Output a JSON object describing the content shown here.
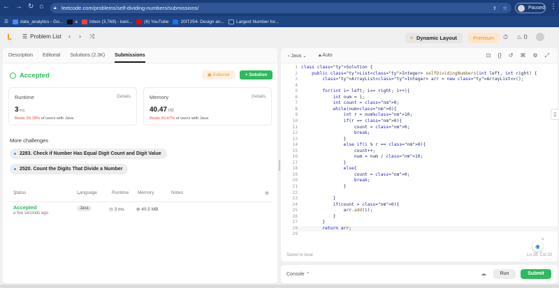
{
  "browser": {
    "url": "leetcode.com/problems/self-dividing-numbers/submissions/",
    "profile_label": "Paused",
    "bookmarks": [
      {
        "label": "data_analytics - Go...",
        "color": "#4a8af4"
      },
      {
        "label": "a",
        "color": "#333333"
      },
      {
        "label": "Inbox (3,769) - kani...",
        "color": "#ea4335"
      },
      {
        "label": "(6) YouTube",
        "color": "#ff0000"
      },
      {
        "label": "20IT254- Design an...",
        "color": "#1a73e8"
      },
      {
        "label": "Largest Number for...",
        "color": "#1a3d78"
      }
    ]
  },
  "header": {
    "problem_list": "Problem List",
    "dynamic_layout": "Dynamic Layout",
    "premium": "Premium",
    "counter": "0"
  },
  "left": {
    "tabs": [
      "Description",
      "Editorial",
      "Solutions (2.3K)",
      "Submissions"
    ],
    "active_tab": "Submissions",
    "result": "Accepted",
    "editorial_btn": "Editorial",
    "solution_btn": "+ Solution",
    "runtime": {
      "label": "Runtime",
      "details": "Details",
      "value": "3",
      "unit": "ms",
      "beats_pct": "Beats 39.18%",
      "beats_suffix": "of users with Java"
    },
    "memory": {
      "label": "Memory",
      "details": "Details",
      "value": "40.47",
      "unit": "MB",
      "beats_pct": "Beats 30.47%",
      "beats_suffix": "of users with Java"
    },
    "more_title": "More challenges",
    "challenges": [
      "2283. Check if Number Has Equal Digit Count and Digit Value",
      "2520. Count the Digits That Divide a Number"
    ],
    "table": {
      "headers": [
        "Status",
        "Language",
        "Runtime",
        "Memory",
        "Notes"
      ],
      "row": {
        "status": "Accepted",
        "time": "a few seconds ago",
        "language": "Java",
        "runtime": "3 ms",
        "memory": "40.5 MB"
      }
    }
  },
  "editor": {
    "language": "Java",
    "mode": "Auto",
    "saved": "Saved to local",
    "cursor": "Ln 28, Col 20",
    "lines": [
      "class Solution {",
      "    public List<Integer> selfDividingNumbers(int left, int right) {",
      "        ArrayList<Integer> arr = new ArrayList<>();",
      "",
      "        for(int i= left; i<= right; i++){",
      "            int num = i;",
      "            int count = 0;",
      "            while(num>0){",
      "                int r = num%10;",
      "                if(r == 0){",
      "                    count = 0;",
      "                    break;",
      "                }",
      "                else if(i % r == 0){",
      "                    count++;",
      "                    num = num / 10;",
      "                }",
      "                else{",
      "                    count = 0;",
      "                    break;",
      "                }",
      "",
      "            }",
      "            if(count > 0){",
      "                arr.add(i);",
      "            }",
      "        }",
      "        return arr;",
      ""
    ]
  },
  "console": {
    "label": "Console",
    "run": "Run",
    "submit": "Submit"
  }
}
